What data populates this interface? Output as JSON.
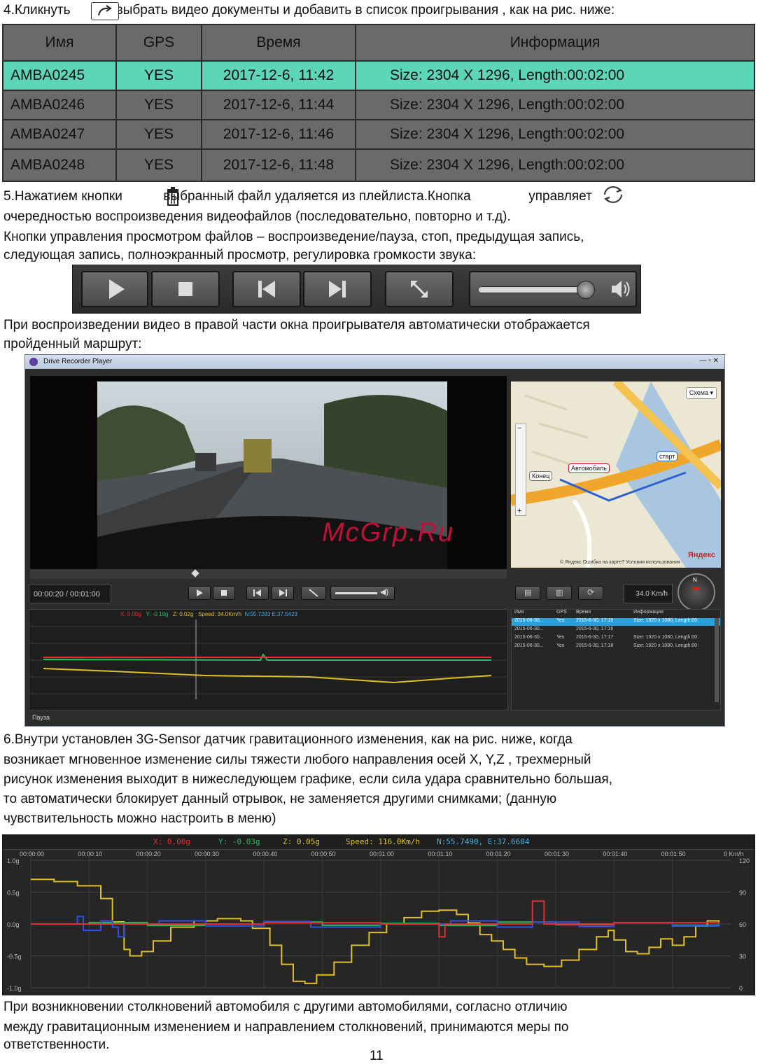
{
  "step4": {
    "text_before": "4.Кликнуть",
    "text_after": ", выбрать видео документы и добавить в список проигрывания , как на рис. ниже:",
    "icon": "open-folder-icon"
  },
  "file_table": {
    "columns": [
      "Имя",
      "GPS",
      "Время",
      "Информация"
    ],
    "rows": [
      {
        "name": "AMBA0245",
        "gps": "YES",
        "time": "2017-12-6, 11:42",
        "info": "Size: 2304 X 1296, Length:00:02:00"
      },
      {
        "name": "AMBA0246",
        "gps": "YES",
        "time": "2017-12-6, 11:44",
        "info": "Size: 2304 X 1296, Length:00:02:00"
      },
      {
        "name": "AMBA0247",
        "gps": "YES",
        "time": "2017-12-6, 11:46",
        "info": "Size: 2304 X 1296, Length:00:02:00"
      },
      {
        "name": "AMBA0248",
        "gps": "YES",
        "time": "2017-12-6, 11:48",
        "info": "Size: 2304 X 1296, Length:00:02:00"
      }
    ],
    "selected_index": 0,
    "colors": {
      "selected": "#5dd6b8",
      "body": "#6a6a6a"
    }
  },
  "step5": {
    "line1_a": "5.Нажатием кнопки",
    "line1_b": "выбранный файл удаляется из плейлиста.Кнопка",
    "line1_c": "управляет",
    "line2": "очередностью воспроизведения видеофайлов (последовательно, повторно и т.д).",
    "line3": "Кнопки управления просмотром файлов – воспроизведение/пауза, стоп, предыдущая запись,",
    "line4": "следующая запись, полноэкранный просмотр, регулировка громкости звука:",
    "icons": [
      "trash-icon",
      "repeat-icon"
    ]
  },
  "controls": {
    "buttons": [
      "play-icon",
      "stop-icon",
      "previous-icon",
      "next-icon",
      "fullscreen-icon"
    ],
    "volume_level": 0.95
  },
  "route_text": {
    "line1": "При воспроизведении видео в правой части окна проигрывателя автоматически отображается",
    "line2": "пройденный маршрут:"
  },
  "player": {
    "title": "Drive Recorder Player",
    "time_display": "00:00:20 / 00:01:00",
    "speed_display": "34.0 Km/h",
    "readout": {
      "x": "X:  0.00g",
      "y": "Y: -0.19g",
      "z": "Z: 0.02g",
      "speed": "Speed:  34.0Km/h",
      "gps": "N:55.7283  E:37.5423"
    },
    "status": "Пауза",
    "map": {
      "scheme_label": "Схема ▾",
      "markers": {
        "start": "старт",
        "car": "Автомобиль",
        "end": "Конец"
      },
      "attribution": "© Яндекс   Ошибка на карте?   Условия использования",
      "brand": "Яндекс"
    },
    "list": {
      "columns": [
        "Имя",
        "GPS",
        "Время",
        "Информация"
      ],
      "rows": [
        {
          "name": "2015-06-30...",
          "gps": "Yes",
          "time": "2015-6-30, 17:15",
          "info": "Size: 1920 x 1080, Length:00:"
        },
        {
          "name": "2015-06-30...",
          "gps": "",
          "time": "2015-6-30, 17:16",
          "info": ""
        },
        {
          "name": "2015-06-30...",
          "gps": "Yes",
          "time": "2015-6-30, 17:17",
          "info": "Size: 1920 x 1080, Length:00:"
        },
        {
          "name": "2015-06-30...",
          "gps": "Yes",
          "time": "2015-6-30, 17:18",
          "info": "Size: 1920 x 1080, Length:00:"
        }
      ]
    }
  },
  "step6": {
    "line1": "6.Внутри установлен 3G-Sensor датчик гравитационного изменения, как на рис. ниже, когда",
    "line2": "возникает мгновенное изменение силы тяжести любого направления осей X, Y,Z , трехмерный",
    "line3": "рисунок изменения выходит в нижеследующем графике, если сила удара сравнительно большая,",
    "line4": "то автоматически блокирует данный отрывок, не заменяется другими снимками; (данную",
    "line5": "чувствительность можно настроить в меню)"
  },
  "chart_data": {
    "type": "line",
    "readout": {
      "x": "X:  0.00g",
      "y": "Y:  -0.03g",
      "z": "Z:  0.05g",
      "speed": "Speed:  116.0Km/h",
      "gps": "N:55.7490,  E:37.6684"
    },
    "x_ticks": [
      "00:00:00",
      "00:00:10",
      "00:00:20",
      "00:00:30",
      "00:00:40",
      "00:00:50",
      "00:01:00",
      "00:01:10",
      "00:01:20",
      "00:01:30",
      "00:01:40",
      "00:01:50"
    ],
    "x_unit": "0  Km/h",
    "y_left_ticks": [
      "1.0g",
      "0.5g",
      "0.0g",
      "-0.5g",
      "-1.0g"
    ],
    "y_left_range": [
      -1.0,
      1.0
    ],
    "y_right_ticks": [
      "120",
      "90",
      "60",
      "30",
      "0"
    ],
    "y_right_range": [
      0,
      120
    ],
    "x_range": [
      0,
      120
    ],
    "grid": true,
    "series": [
      {
        "color": "#e0c028",
        "axis": "right",
        "points": [
          [
            0,
            102
          ],
          [
            4,
            100
          ],
          [
            8,
            96
          ],
          [
            12,
            84
          ],
          [
            14,
            62
          ],
          [
            16,
            36
          ],
          [
            17,
            30
          ],
          [
            19,
            34
          ],
          [
            21,
            44
          ],
          [
            24,
            57
          ],
          [
            28,
            63
          ],
          [
            32,
            65
          ],
          [
            36,
            63
          ],
          [
            38,
            56
          ],
          [
            41,
            40
          ],
          [
            43,
            22
          ],
          [
            45,
            6
          ],
          [
            47,
            4
          ],
          [
            49,
            12
          ],
          [
            52,
            24
          ],
          [
            55,
            40
          ],
          [
            58,
            52
          ],
          [
            61,
            60
          ],
          [
            64,
            66
          ],
          [
            67,
            72
          ],
          [
            70,
            73
          ],
          [
            73,
            69
          ],
          [
            75,
            61
          ],
          [
            77,
            50
          ],
          [
            79,
            44
          ],
          [
            81,
            36
          ],
          [
            83,
            28
          ],
          [
            85,
            22
          ],
          [
            88,
            20
          ],
          [
            91,
            26
          ],
          [
            94,
            36
          ],
          [
            97,
            48
          ],
          [
            99,
            54
          ],
          [
            100,
            45
          ],
          [
            102,
            34
          ],
          [
            104,
            32
          ],
          [
            106,
            38
          ],
          [
            108,
            46
          ],
          [
            110,
            40
          ],
          [
            112,
            48
          ],
          [
            114,
            58
          ],
          [
            116,
            63
          ],
          [
            118,
            62
          ]
        ]
      },
      {
        "color": "#22c060",
        "axis": "left",
        "points": [
          [
            0,
            0.0
          ],
          [
            10,
            0.02
          ],
          [
            20,
            -0.02
          ],
          [
            30,
            0.0
          ],
          [
            40,
            0.03
          ],
          [
            50,
            -0.02
          ],
          [
            60,
            0.01
          ],
          [
            70,
            -0.02
          ],
          [
            80,
            0.03
          ],
          [
            90,
            -0.01
          ],
          [
            100,
            0.02
          ],
          [
            110,
            -0.02
          ],
          [
            118,
            0.0
          ]
        ]
      },
      {
        "color": "#3050e0",
        "axis": "left",
        "points": [
          [
            0,
            0.0
          ],
          [
            6,
            0.0
          ],
          [
            8,
            0.12
          ],
          [
            9,
            -0.1
          ],
          [
            12,
            0.05
          ],
          [
            14,
            -0.05
          ],
          [
            15,
            -0.2
          ],
          [
            16,
            0.0
          ],
          [
            22,
            0.05
          ],
          [
            30,
            -0.03
          ],
          [
            40,
            0.04
          ],
          [
            48,
            -0.05
          ],
          [
            60,
            0.0
          ],
          [
            72,
            0.05
          ],
          [
            80,
            -0.05
          ],
          [
            86,
            0.03
          ],
          [
            94,
            -0.04
          ],
          [
            100,
            0.02
          ],
          [
            110,
            -0.03
          ],
          [
            118,
            0.02
          ]
        ]
      },
      {
        "color": "#e03030",
        "axis": "left",
        "points": [
          [
            0,
            0.0
          ],
          [
            20,
            0.0
          ],
          [
            40,
            0.02
          ],
          [
            60,
            0.0
          ],
          [
            70,
            -0.2
          ],
          [
            71,
            0.0
          ],
          [
            85,
            0.0
          ],
          [
            86,
            0.36
          ],
          [
            87,
            0.36
          ],
          [
            88,
            0.0
          ],
          [
            100,
            0.02
          ],
          [
            118,
            0.0
          ]
        ]
      }
    ]
  },
  "final_text": {
    "line1": "При возникновении столкновений автомобиля с другими автомобилями, согласно отличию",
    "line2": "между гравитационным изменением и направлением столкновений, принимаются меры по",
    "line3": "ответственности."
  },
  "page_number": "11",
  "watermark": "McGrp.Ru"
}
